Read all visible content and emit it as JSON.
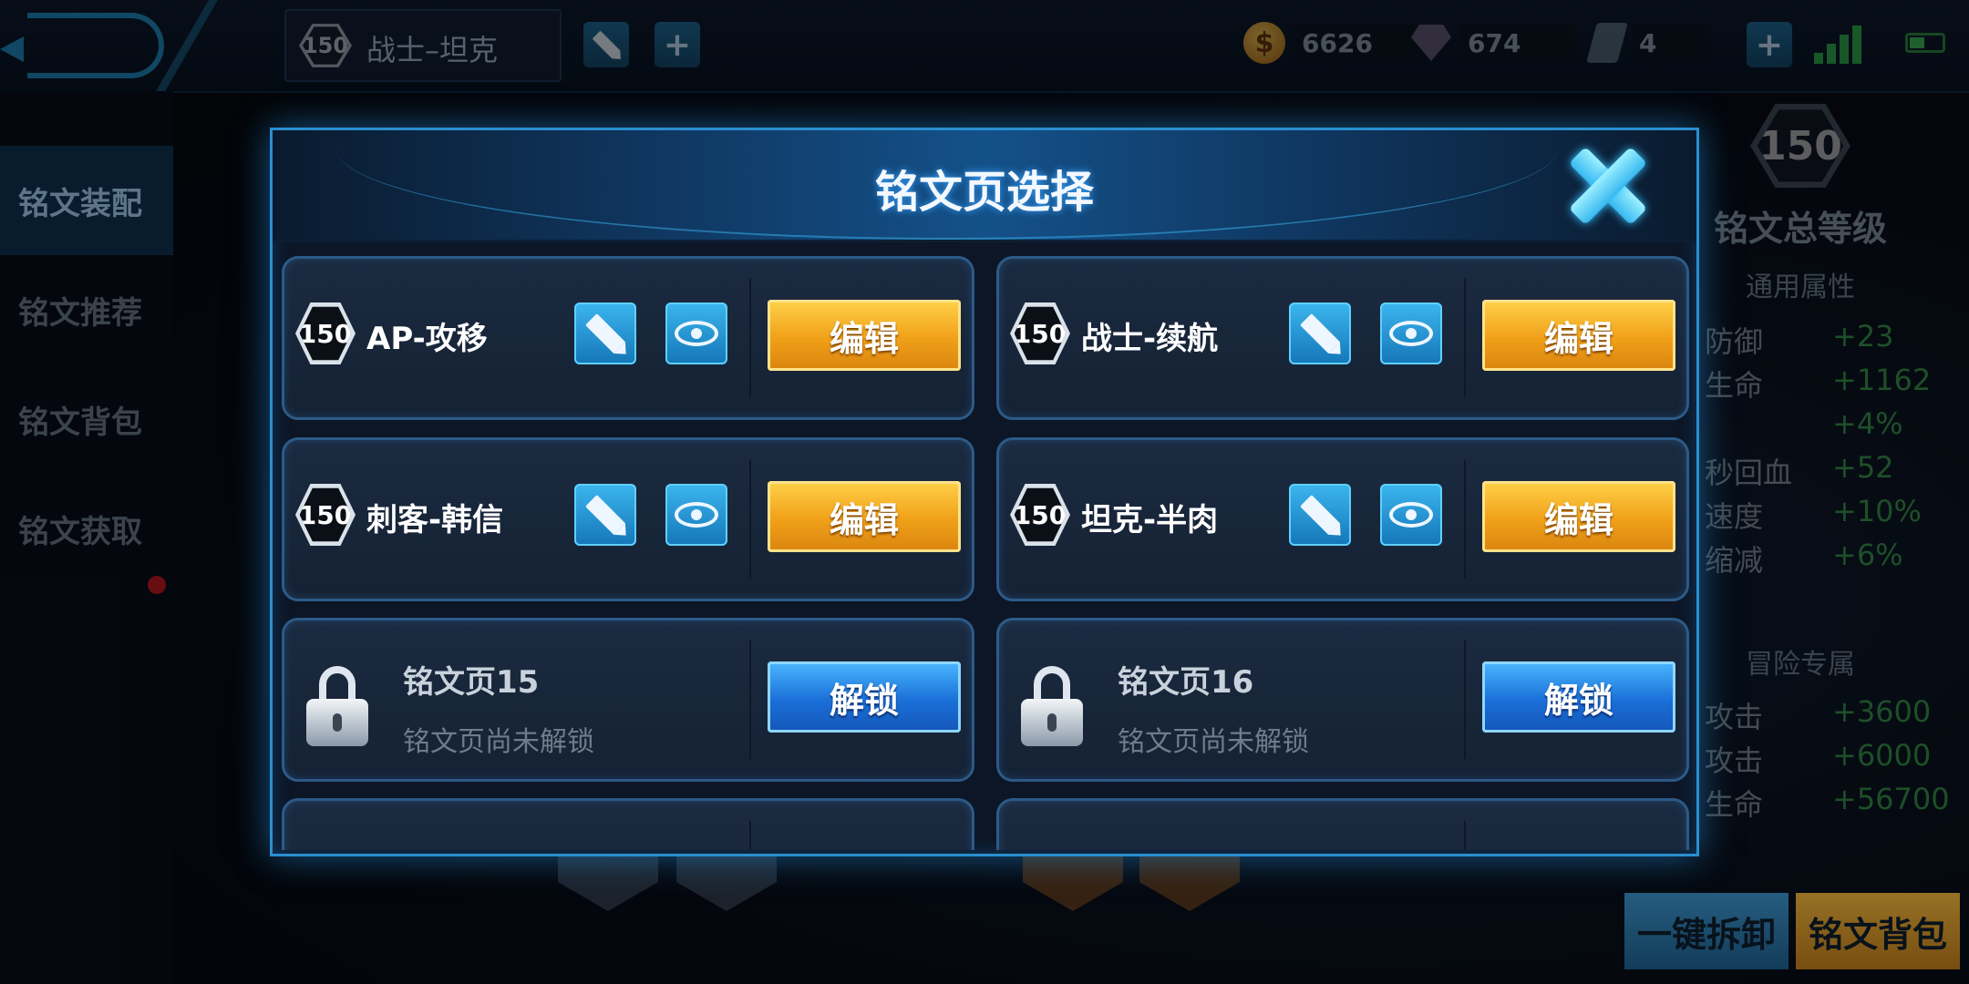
{
  "topbar": {
    "page_chip": {
      "level": "150",
      "name": "战士–坦克"
    },
    "currencies": [
      {
        "icon": "gold-coin-icon",
        "value": "6626"
      },
      {
        "icon": "diamond-icon",
        "value": "674"
      },
      {
        "icon": "card-icon",
        "value": "4"
      }
    ]
  },
  "sidebar": {
    "items": [
      {
        "label": "铭文装配",
        "active": true
      },
      {
        "label": "铭文推荐"
      },
      {
        "label": "铭文背包"
      },
      {
        "label": "铭文获取"
      }
    ]
  },
  "right_panel": {
    "total_level": "150",
    "total_level_label": "铭文总等级",
    "general_title": "通用属性",
    "general_rows": [
      {
        "label": "防御",
        "value": "+23"
      },
      {
        "label": "生命",
        "value": "+1162"
      },
      {
        "label": "",
        "value": "+4%"
      },
      {
        "label": "秒回血",
        "value": "+52"
      },
      {
        "label": "速度",
        "value": "+10%"
      },
      {
        "label": "缩减",
        "value": "+6%"
      }
    ],
    "adventure_title": "冒险专属",
    "adventure_rows": [
      {
        "label": "攻击",
        "value": "+3600"
      },
      {
        "label": "攻击",
        "value": "+6000"
      },
      {
        "label": "生命",
        "value": "+56700"
      }
    ],
    "dismantle_button": "一键拆卸",
    "bag_button": "铭文背包"
  },
  "modal": {
    "title": "铭文页选择",
    "pages": [
      {
        "level": "150",
        "name": "AP-攻移",
        "action": "编辑"
      },
      {
        "level": "150",
        "name": "战士-续航",
        "action": "编辑"
      },
      {
        "level": "150",
        "name": "刺客-韩信",
        "action": "编辑"
      },
      {
        "level": "150",
        "name": "坦克-半肉",
        "action": "编辑"
      }
    ],
    "locked_pages": [
      {
        "name": "铭文页15",
        "subtitle": "铭文页尚未解锁",
        "action": "解锁"
      },
      {
        "name": "铭文页16",
        "subtitle": "铭文页尚未解锁",
        "action": "解锁"
      }
    ]
  },
  "colors": {
    "accent_blue": "#2a8fd0",
    "edit_gold": "#f0a018",
    "unlock_blue": "#1a6fd8",
    "stat_green": "#2f7a3e"
  }
}
